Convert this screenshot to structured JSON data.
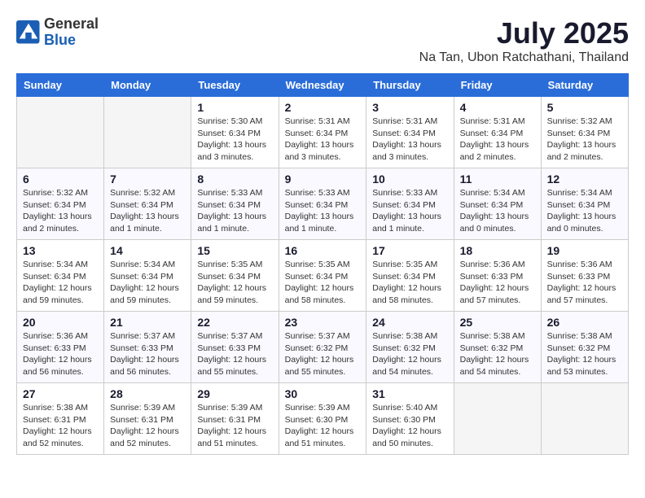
{
  "header": {
    "logo": {
      "general": "General",
      "blue": "Blue"
    },
    "title": "July 2025",
    "location": "Na Tan, Ubon Ratchathani, Thailand"
  },
  "weekdays": [
    "Sunday",
    "Monday",
    "Tuesday",
    "Wednesday",
    "Thursday",
    "Friday",
    "Saturday"
  ],
  "weeks": [
    [
      {
        "day": "",
        "empty": true
      },
      {
        "day": "",
        "empty": true
      },
      {
        "day": "1",
        "sunrise": "Sunrise: 5:30 AM",
        "sunset": "Sunset: 6:34 PM",
        "daylight": "Daylight: 13 hours and 3 minutes."
      },
      {
        "day": "2",
        "sunrise": "Sunrise: 5:31 AM",
        "sunset": "Sunset: 6:34 PM",
        "daylight": "Daylight: 13 hours and 3 minutes."
      },
      {
        "day": "3",
        "sunrise": "Sunrise: 5:31 AM",
        "sunset": "Sunset: 6:34 PM",
        "daylight": "Daylight: 13 hours and 3 minutes."
      },
      {
        "day": "4",
        "sunrise": "Sunrise: 5:31 AM",
        "sunset": "Sunset: 6:34 PM",
        "daylight": "Daylight: 13 hours and 2 minutes."
      },
      {
        "day": "5",
        "sunrise": "Sunrise: 5:32 AM",
        "sunset": "Sunset: 6:34 PM",
        "daylight": "Daylight: 13 hours and 2 minutes."
      }
    ],
    [
      {
        "day": "6",
        "sunrise": "Sunrise: 5:32 AM",
        "sunset": "Sunset: 6:34 PM",
        "daylight": "Daylight: 13 hours and 2 minutes."
      },
      {
        "day": "7",
        "sunrise": "Sunrise: 5:32 AM",
        "sunset": "Sunset: 6:34 PM",
        "daylight": "Daylight: 13 hours and 1 minute."
      },
      {
        "day": "8",
        "sunrise": "Sunrise: 5:33 AM",
        "sunset": "Sunset: 6:34 PM",
        "daylight": "Daylight: 13 hours and 1 minute."
      },
      {
        "day": "9",
        "sunrise": "Sunrise: 5:33 AM",
        "sunset": "Sunset: 6:34 PM",
        "daylight": "Daylight: 13 hours and 1 minute."
      },
      {
        "day": "10",
        "sunrise": "Sunrise: 5:33 AM",
        "sunset": "Sunset: 6:34 PM",
        "daylight": "Daylight: 13 hours and 1 minute."
      },
      {
        "day": "11",
        "sunrise": "Sunrise: 5:34 AM",
        "sunset": "Sunset: 6:34 PM",
        "daylight": "Daylight: 13 hours and 0 minutes."
      },
      {
        "day": "12",
        "sunrise": "Sunrise: 5:34 AM",
        "sunset": "Sunset: 6:34 PM",
        "daylight": "Daylight: 13 hours and 0 minutes."
      }
    ],
    [
      {
        "day": "13",
        "sunrise": "Sunrise: 5:34 AM",
        "sunset": "Sunset: 6:34 PM",
        "daylight": "Daylight: 12 hours and 59 minutes."
      },
      {
        "day": "14",
        "sunrise": "Sunrise: 5:34 AM",
        "sunset": "Sunset: 6:34 PM",
        "daylight": "Daylight: 12 hours and 59 minutes."
      },
      {
        "day": "15",
        "sunrise": "Sunrise: 5:35 AM",
        "sunset": "Sunset: 6:34 PM",
        "daylight": "Daylight: 12 hours and 59 minutes."
      },
      {
        "day": "16",
        "sunrise": "Sunrise: 5:35 AM",
        "sunset": "Sunset: 6:34 PM",
        "daylight": "Daylight: 12 hours and 58 minutes."
      },
      {
        "day": "17",
        "sunrise": "Sunrise: 5:35 AM",
        "sunset": "Sunset: 6:34 PM",
        "daylight": "Daylight: 12 hours and 58 minutes."
      },
      {
        "day": "18",
        "sunrise": "Sunrise: 5:36 AM",
        "sunset": "Sunset: 6:33 PM",
        "daylight": "Daylight: 12 hours and 57 minutes."
      },
      {
        "day": "19",
        "sunrise": "Sunrise: 5:36 AM",
        "sunset": "Sunset: 6:33 PM",
        "daylight": "Daylight: 12 hours and 57 minutes."
      }
    ],
    [
      {
        "day": "20",
        "sunrise": "Sunrise: 5:36 AM",
        "sunset": "Sunset: 6:33 PM",
        "daylight": "Daylight: 12 hours and 56 minutes."
      },
      {
        "day": "21",
        "sunrise": "Sunrise: 5:37 AM",
        "sunset": "Sunset: 6:33 PM",
        "daylight": "Daylight: 12 hours and 56 minutes."
      },
      {
        "day": "22",
        "sunrise": "Sunrise: 5:37 AM",
        "sunset": "Sunset: 6:33 PM",
        "daylight": "Daylight: 12 hours and 55 minutes."
      },
      {
        "day": "23",
        "sunrise": "Sunrise: 5:37 AM",
        "sunset": "Sunset: 6:32 PM",
        "daylight": "Daylight: 12 hours and 55 minutes."
      },
      {
        "day": "24",
        "sunrise": "Sunrise: 5:38 AM",
        "sunset": "Sunset: 6:32 PM",
        "daylight": "Daylight: 12 hours and 54 minutes."
      },
      {
        "day": "25",
        "sunrise": "Sunrise: 5:38 AM",
        "sunset": "Sunset: 6:32 PM",
        "daylight": "Daylight: 12 hours and 54 minutes."
      },
      {
        "day": "26",
        "sunrise": "Sunrise: 5:38 AM",
        "sunset": "Sunset: 6:32 PM",
        "daylight": "Daylight: 12 hours and 53 minutes."
      }
    ],
    [
      {
        "day": "27",
        "sunrise": "Sunrise: 5:38 AM",
        "sunset": "Sunset: 6:31 PM",
        "daylight": "Daylight: 12 hours and 52 minutes."
      },
      {
        "day": "28",
        "sunrise": "Sunrise: 5:39 AM",
        "sunset": "Sunset: 6:31 PM",
        "daylight": "Daylight: 12 hours and 52 minutes."
      },
      {
        "day": "29",
        "sunrise": "Sunrise: 5:39 AM",
        "sunset": "Sunset: 6:31 PM",
        "daylight": "Daylight: 12 hours and 51 minutes."
      },
      {
        "day": "30",
        "sunrise": "Sunrise: 5:39 AM",
        "sunset": "Sunset: 6:30 PM",
        "daylight": "Daylight: 12 hours and 51 minutes."
      },
      {
        "day": "31",
        "sunrise": "Sunrise: 5:40 AM",
        "sunset": "Sunset: 6:30 PM",
        "daylight": "Daylight: 12 hours and 50 minutes."
      },
      {
        "day": "",
        "empty": true
      },
      {
        "day": "",
        "empty": true
      }
    ]
  ]
}
